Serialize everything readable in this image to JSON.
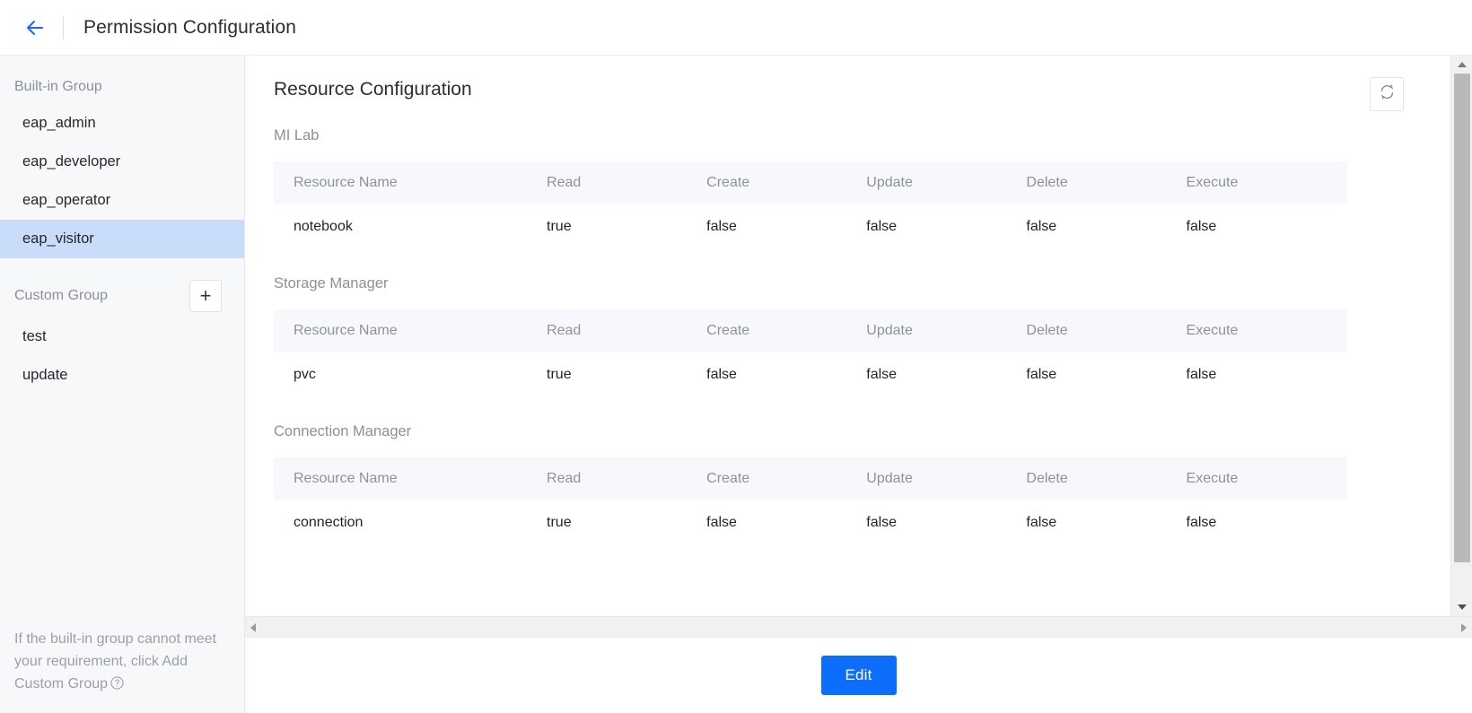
{
  "header": {
    "back_icon": "arrow-left-icon",
    "title": "Permission Configuration"
  },
  "sidebar": {
    "builtin_group_label": "Built-in Group",
    "builtin_items": [
      {
        "label": "eap_admin",
        "selected": false
      },
      {
        "label": "eap_developer",
        "selected": false
      },
      {
        "label": "eap_operator",
        "selected": false
      },
      {
        "label": "eap_visitor",
        "selected": true
      }
    ],
    "custom_group_label": "Custom Group",
    "add_button_label": "+",
    "add_button_icon": "plus-icon",
    "custom_items": [
      {
        "label": "test",
        "selected": false
      },
      {
        "label": "update",
        "selected": false
      }
    ],
    "footer_hint": "If the built-in group cannot meet your requirement, click Add Custom Group",
    "footer_help_icon": "question-circle-icon"
  },
  "main": {
    "page_title": "Resource Configuration",
    "refresh_icon": "refresh-icon",
    "columns": [
      "Resource Name",
      "Read",
      "Create",
      "Update",
      "Delete",
      "Execute"
    ],
    "sections": [
      {
        "label": "MI Lab",
        "rows": [
          {
            "name": "notebook",
            "read": "true",
            "create": "false",
            "update": "false",
            "delete": "false",
            "execute": "false"
          }
        ]
      },
      {
        "label": "Storage Manager",
        "rows": [
          {
            "name": "pvc",
            "read": "true",
            "create": "false",
            "update": "false",
            "delete": "false",
            "execute": "false"
          }
        ]
      },
      {
        "label": "Connection Manager",
        "rows": [
          {
            "name": "connection",
            "read": "true",
            "create": "false",
            "update": "false",
            "delete": "false",
            "execute": "false"
          }
        ]
      }
    ]
  },
  "footer": {
    "edit_label": "Edit"
  },
  "colors": {
    "accent": "#0d6efd",
    "selected_item_bg": "#c9ddfb",
    "sidebar_bg": "#f7f8fa",
    "table_header_bg": "#f7f8fb",
    "muted_text": "#8b9099"
  }
}
